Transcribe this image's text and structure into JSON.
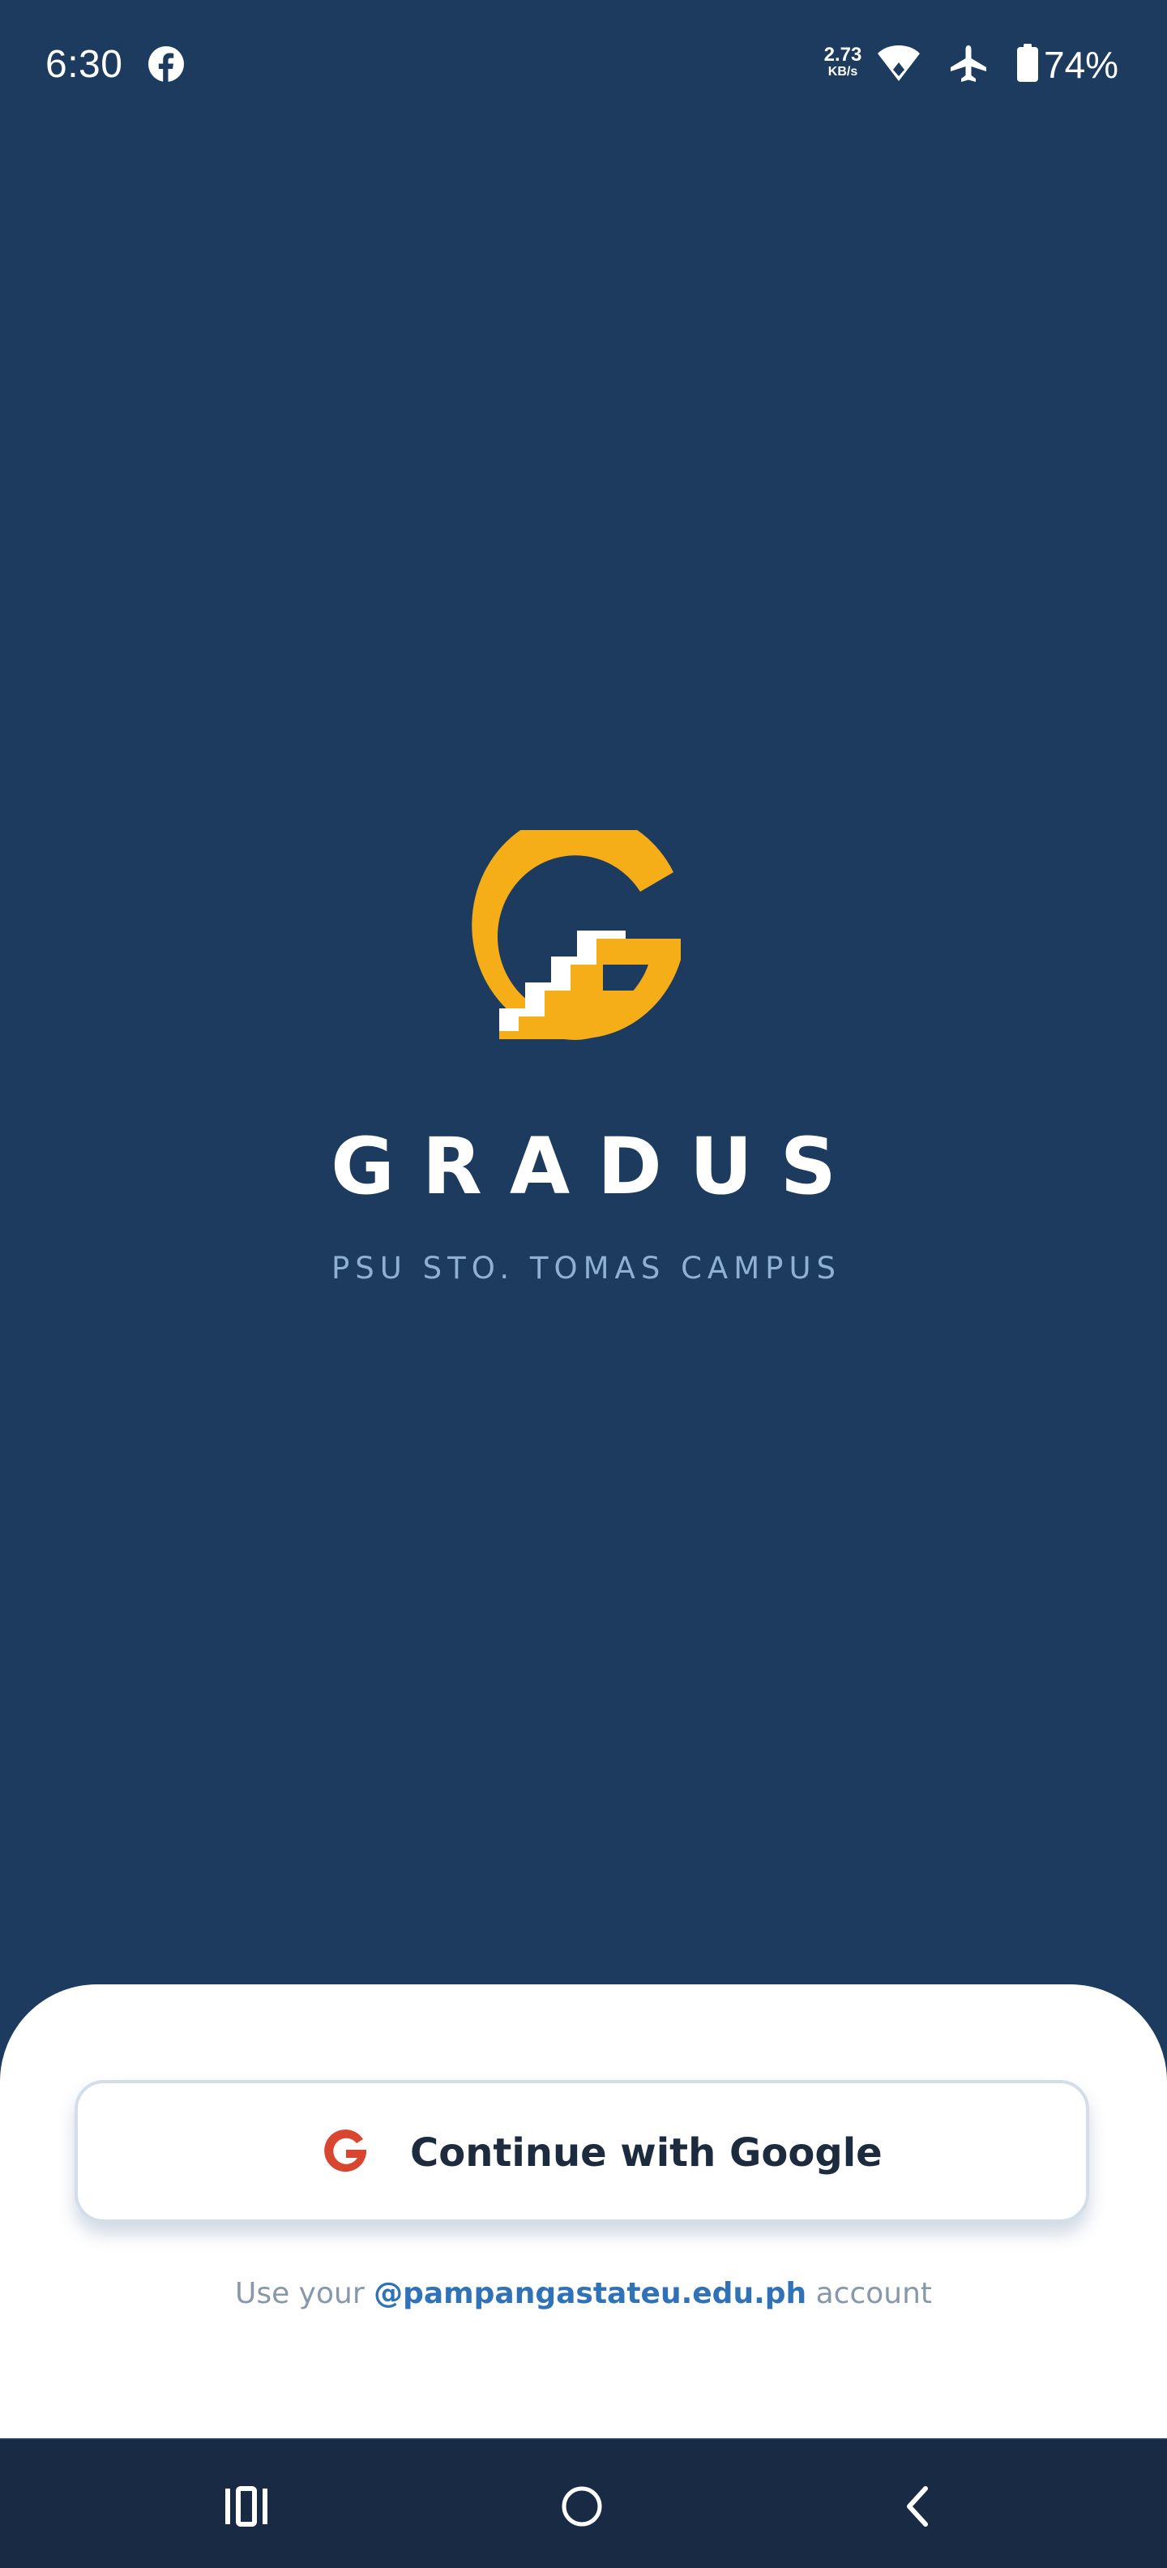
{
  "status_bar": {
    "time": "6:30",
    "network_speed_value": "2.73",
    "network_speed_unit": "KB/s",
    "battery_percent": "74%",
    "icons": [
      "facebook-icon",
      "wifi-icon",
      "airplane-mode-icon",
      "battery-icon"
    ]
  },
  "branding": {
    "logo": "gradus-staircase-g-logo",
    "app_name": "GRADUS",
    "campus": "PSU STO. TOMAS CAMPUS"
  },
  "sign_in": {
    "button_label": "Continue with Google",
    "button_icon": "google-g-icon",
    "hint_prefix": "Use your",
    "hint_domain": "@pampangastateu.edu.ph",
    "hint_suffix": "account"
  },
  "navigation_bar": {
    "buttons": [
      "recent-apps",
      "home",
      "back"
    ]
  },
  "colors": {
    "background": "#1c3b5f",
    "logo_gold": "#f6ae18",
    "subtitle": "#8fb0d4",
    "sheet": "#ffffff",
    "button_text": "#1c2b3e",
    "domain_link": "#2f72b8",
    "hint_text": "#8898ab",
    "nav_bar": "#182a44",
    "google_red": "#d9462f"
  }
}
